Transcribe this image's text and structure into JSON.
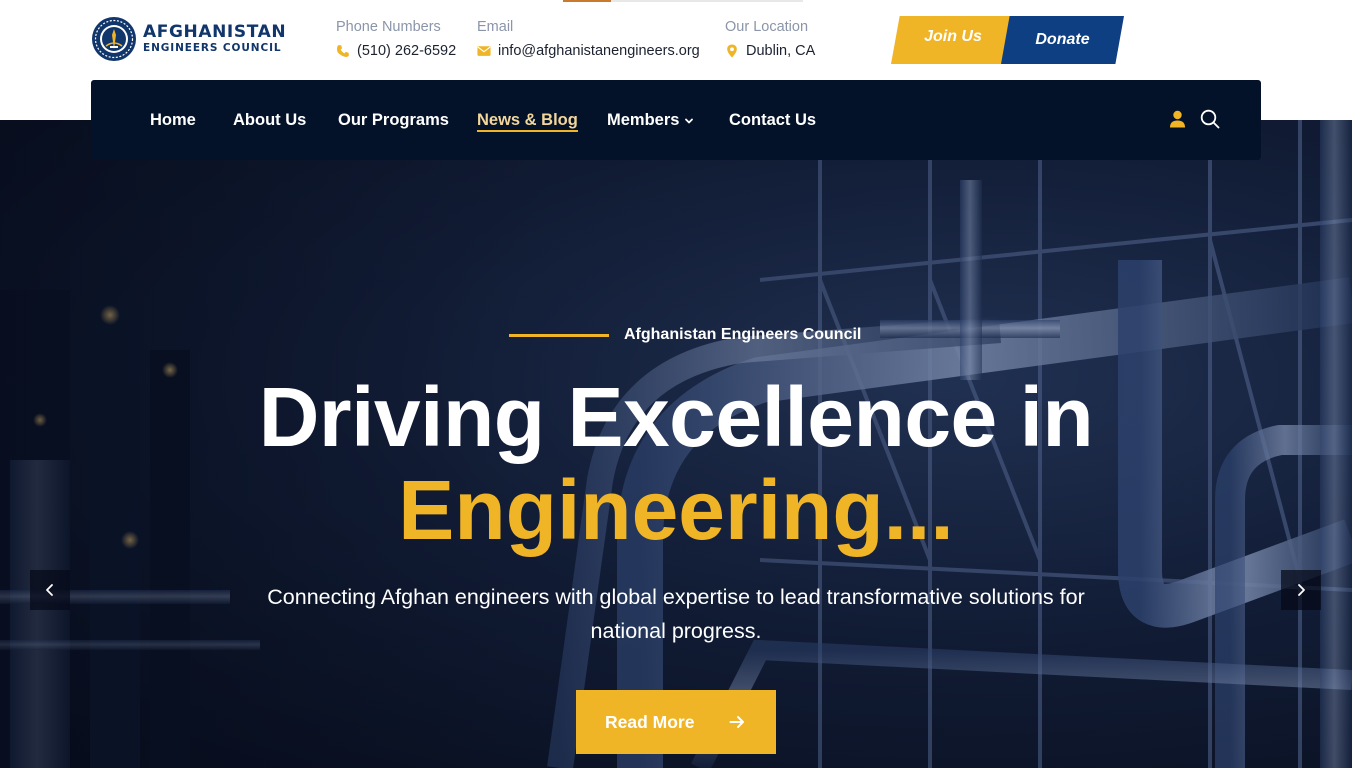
{
  "brand": {
    "name_line1": "AFGHANISTAN",
    "name_line2": "ENGINEERS COUNCIL",
    "logo_icon": "council-seal-icon"
  },
  "contacts": {
    "phone": {
      "label": "Phone Numbers",
      "value": "(510) 262-6592",
      "icon": "phone-icon"
    },
    "email": {
      "label": "Email",
      "value": "info@afghanistanengineers.org",
      "icon": "envelope-icon"
    },
    "location": {
      "label": "Our Location",
      "value": "Dublin, CA",
      "icon": "map-pin-icon"
    }
  },
  "cta": {
    "join_label": "Join Us",
    "donate_label": "Donate"
  },
  "nav": {
    "items": [
      {
        "label": "Home"
      },
      {
        "label": "About Us"
      },
      {
        "label": "Our Programs"
      },
      {
        "label": "News & Blog",
        "active": true
      },
      {
        "label": "Members",
        "has_dropdown": true
      },
      {
        "label": "Contact Us"
      }
    ],
    "user_icon": "user-icon",
    "search_icon": "search-icon"
  },
  "hero": {
    "eyebrow": "Afghanistan Engineers Council",
    "headline": "Driving Excellence in",
    "headline_accent": "Engineering...",
    "subtext": "Connecting Afghan engineers with global expertise to lead transformative solutions for national progress.",
    "button_label": "Read More",
    "button_icon": "arrow-right-icon",
    "prev_icon": "chevron-left-icon",
    "next_icon": "chevron-right-icon"
  },
  "colors": {
    "accent": "#f0b427",
    "brand_blue": "#0d3f82",
    "nav_bg": "#041229",
    "logo_blue": "#11366b"
  }
}
